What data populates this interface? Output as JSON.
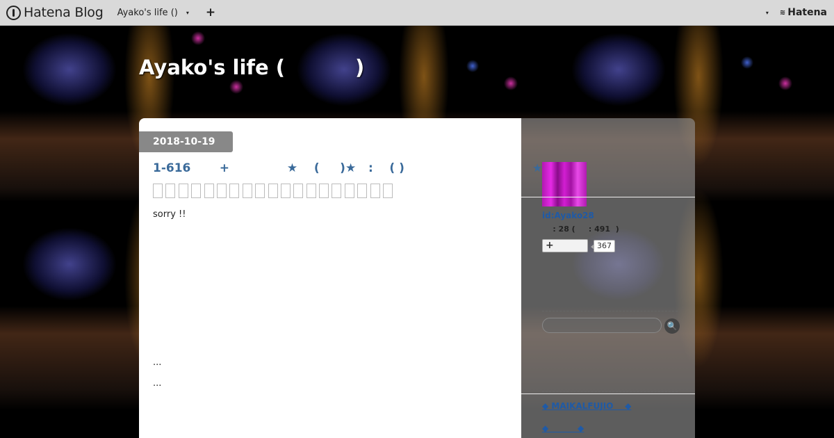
{
  "topbar": {
    "logo_text": "Hatena Blog",
    "blog_selector": "Ayako's life ()",
    "caret": "▾",
    "add_button": "+",
    "menu_caret": "▾",
    "brand_icon": "≋",
    "brand": "Hatena"
  },
  "blog": {
    "title": "Ayako's life (          )"
  },
  "entry": {
    "date": "2018-10-19",
    "title": "1-616       +              ★    (     )★   :    ( )",
    "body_first": "sorry !!",
    "body_dots_1": "...",
    "body_dots_2": "..."
  },
  "sidebar": {
    "star": "★",
    "user_id": "id:Ayako28",
    "reader_stats": "    : 28 (     : 491  )",
    "subscribe_label": "+",
    "subscribe_count": "367",
    "search_icon": "🔍",
    "links": [
      "◆ MAIKALFUJIO    ◆",
      "◆          ◆"
    ]
  }
}
